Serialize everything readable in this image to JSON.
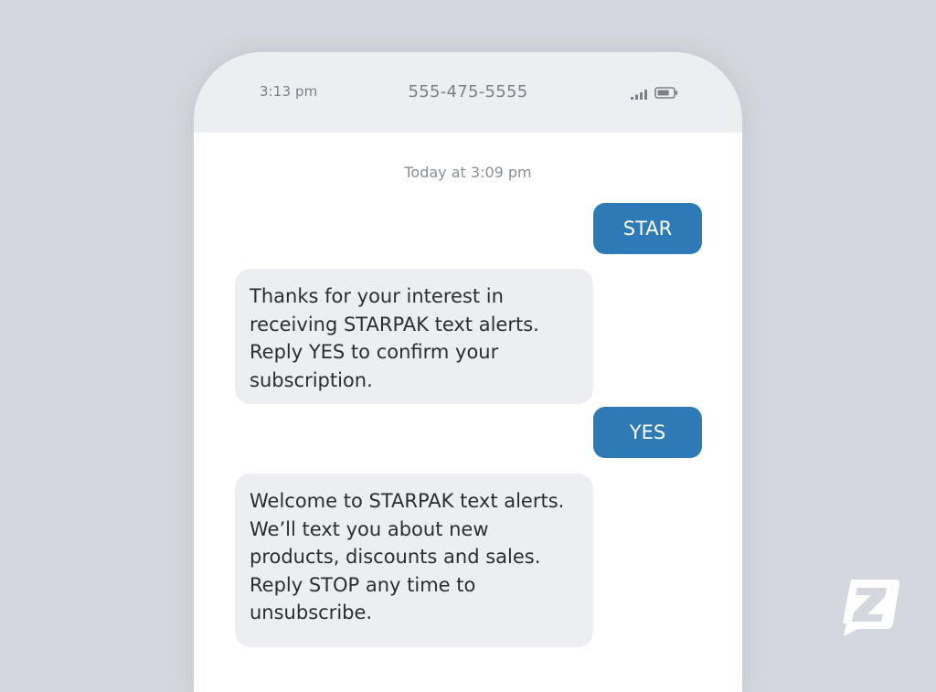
{
  "status_bar": {
    "time": "3:13 pm",
    "phone_number": "555-475-5555",
    "signal_icon": "signal-bars-icon",
    "battery_icon": "battery-icon"
  },
  "conversation": {
    "timestamp": "Today at 3:09 pm",
    "messages": [
      {
        "direction": "outgoing",
        "text": "STAR"
      },
      {
        "direction": "incoming",
        "text": "Thanks for your interest in receiving STARPAK text alerts. Reply YES to confirm your subscription."
      },
      {
        "direction": "outgoing",
        "text": "YES"
      },
      {
        "direction": "incoming",
        "text": "Welcome to STARPAK text alerts. We’ll text you about new products, discounts and sales. Reply STOP any time to unsubscribe."
      }
    ]
  },
  "brand": {
    "logo_icon": "z-chat-logo-icon"
  },
  "colors": {
    "background": "#d4d8de",
    "outgoing_bubble": "#2d7ab6",
    "incoming_bubble": "#eceef1",
    "status_bar": "#eceef1"
  }
}
